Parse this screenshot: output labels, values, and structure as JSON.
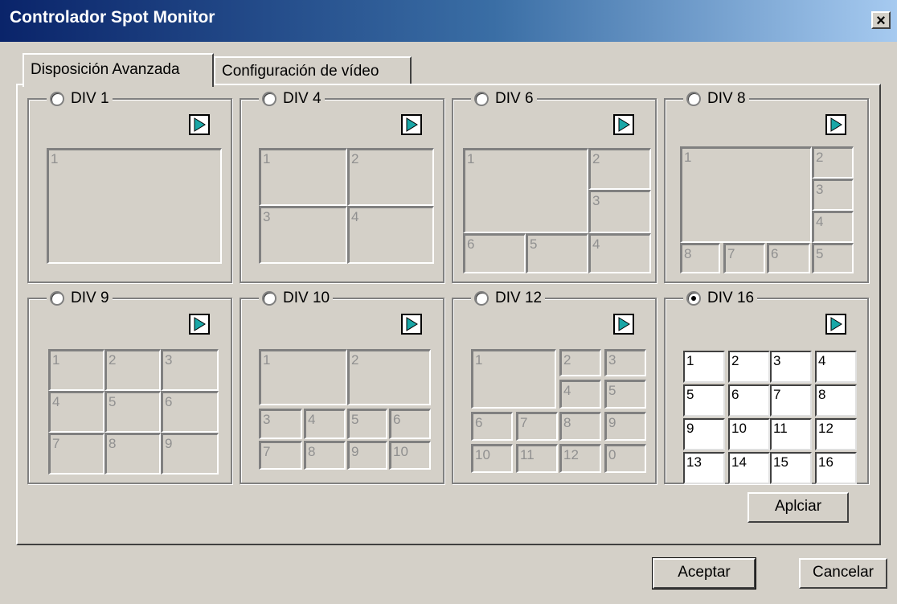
{
  "window": {
    "title": "Controlador Spot Monitor",
    "close_label": "×"
  },
  "tabs": [
    {
      "label": "Disposición Avanzada",
      "active": true
    },
    {
      "label": "Configuración de vídeo",
      "active": false
    }
  ],
  "layouts": [
    {
      "label": "DIV 1",
      "selected": false,
      "cells": [
        "1"
      ]
    },
    {
      "label": "DIV 4",
      "selected": false,
      "cells": [
        "1",
        "2",
        "3",
        "4"
      ]
    },
    {
      "label": "DIV 6",
      "selected": false,
      "cells": [
        "1",
        "2",
        "3",
        "6",
        "5",
        "4"
      ]
    },
    {
      "label": "DIV 8",
      "selected": false,
      "cells": [
        "1",
        "2",
        "3",
        "4",
        "8",
        "7",
        "6",
        "5"
      ]
    },
    {
      "label": "DIV 9",
      "selected": false,
      "cells": [
        "1",
        "2",
        "3",
        "4",
        "5",
        "6",
        "7",
        "8",
        "9"
      ]
    },
    {
      "label": "DIV 10",
      "selected": false,
      "cells": [
        "1",
        "2",
        "3",
        "4",
        "5",
        "6",
        "7",
        "8",
        "9",
        "10"
      ]
    },
    {
      "label": "DIV 12",
      "selected": false,
      "cells": [
        "1",
        "2",
        "3",
        "4",
        "5",
        "6",
        "7",
        "8",
        "9",
        "10",
        "11",
        "12",
        "0"
      ]
    },
    {
      "label": "DIV 16",
      "selected": true,
      "cells": [
        "1",
        "2",
        "3",
        "4",
        "5",
        "6",
        "7",
        "8",
        "9",
        "10",
        "11",
        "12",
        "13",
        "14",
        "15",
        "16"
      ]
    }
  ],
  "buttons": {
    "apply": "Aplciar",
    "accept": "Aceptar",
    "cancel": "Cancelar"
  },
  "colors": {
    "title_start": "#0a246a",
    "title_end": "#a6caf0",
    "face": "#d4d0c8",
    "play_icon": "#19a7a7"
  }
}
